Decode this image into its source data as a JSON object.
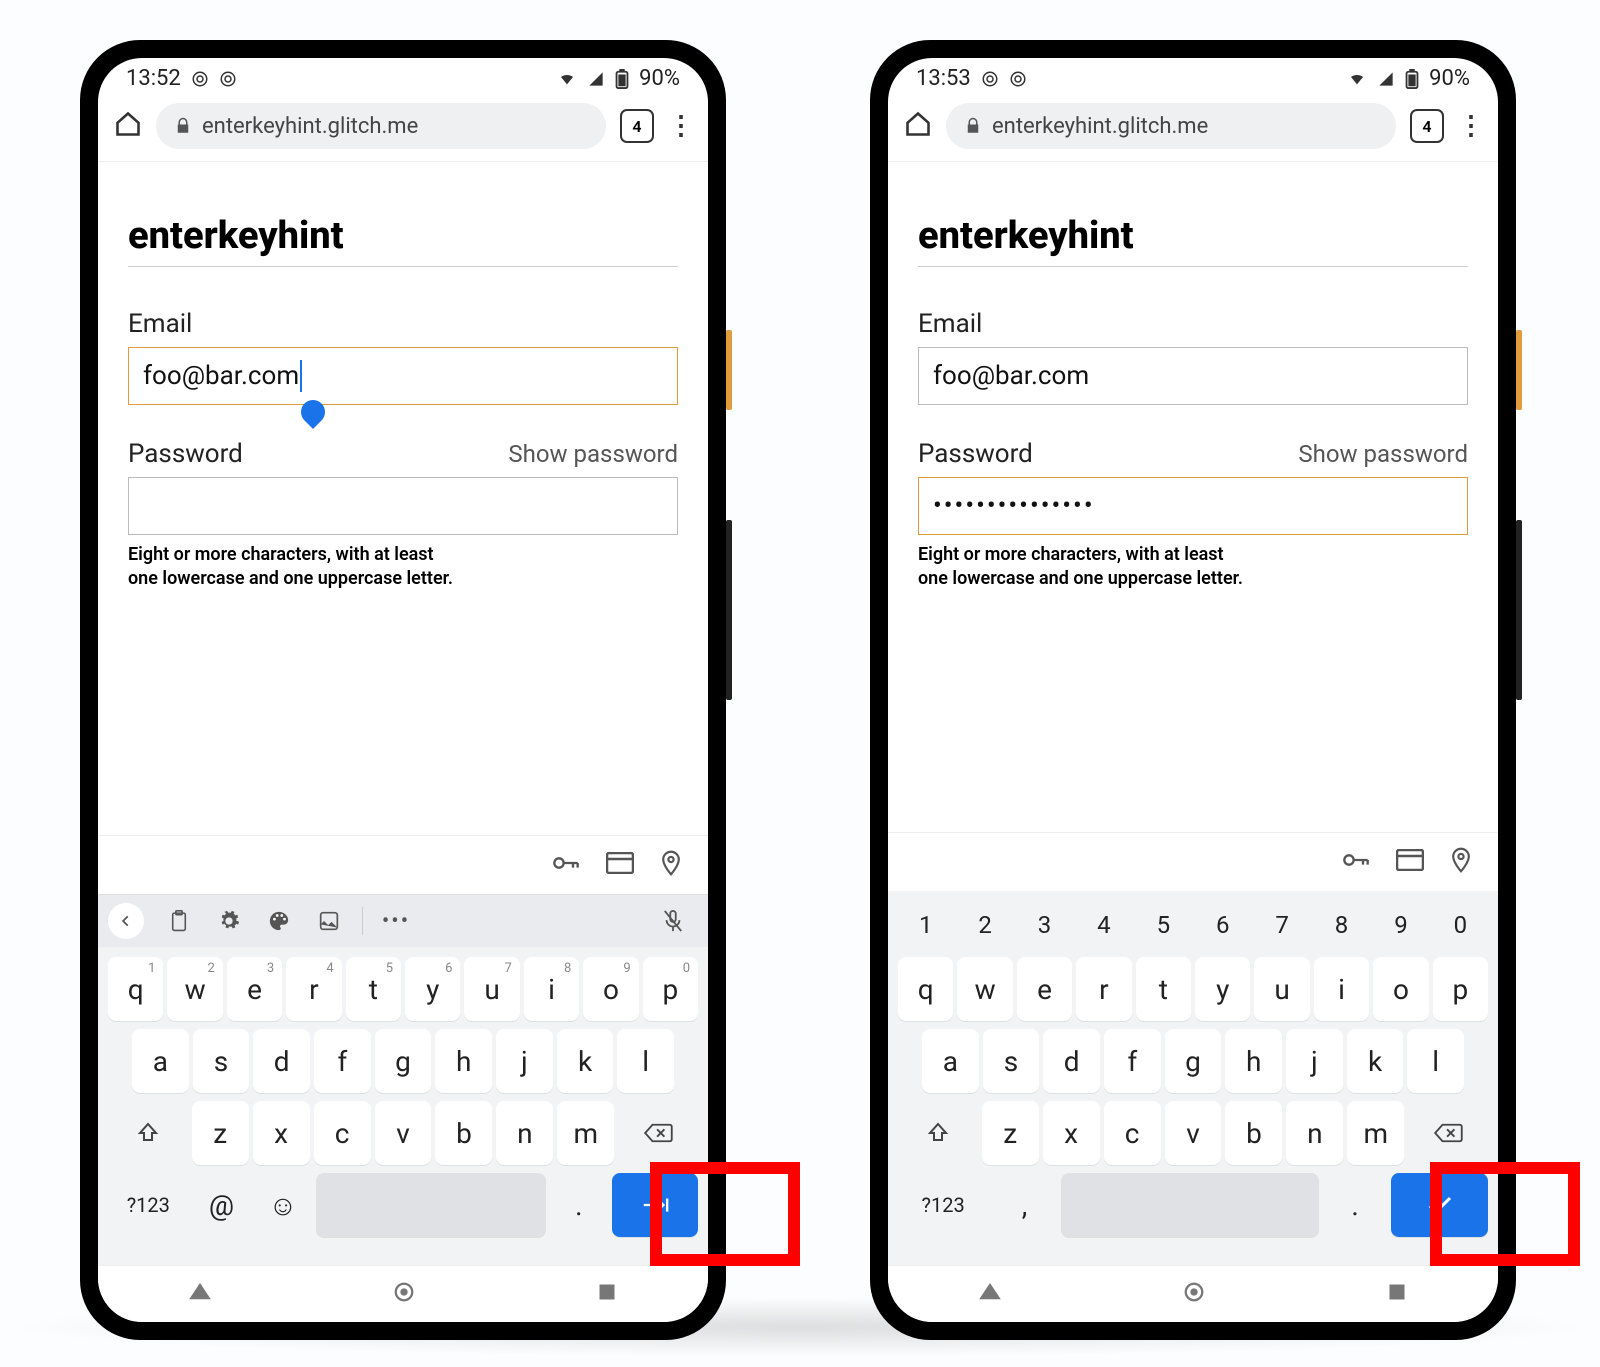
{
  "phones": {
    "left": {
      "status": {
        "time": "13:52",
        "battery": "90%"
      },
      "url": "enterkeyhint.glitch.me",
      "tab_count": "4",
      "page": {
        "title": "enterkeyhint",
        "email_label": "Email",
        "email_value": "foo@bar.com",
        "password_label": "Password",
        "show_password": "Show password",
        "password_value": "",
        "hint_line1": "Eight or more characters, with at least",
        "hint_line2": "one lowercase and one uppercase letter."
      },
      "keyboard": {
        "row1": [
          "q",
          "w",
          "e",
          "r",
          "t",
          "y",
          "u",
          "i",
          "o",
          "p"
        ],
        "row1_sup": [
          "1",
          "2",
          "3",
          "4",
          "5",
          "6",
          "7",
          "8",
          "9",
          "0"
        ],
        "row2": [
          "a",
          "s",
          "d",
          "f",
          "g",
          "h",
          "j",
          "k",
          "l"
        ],
        "row3": [
          "z",
          "x",
          "c",
          "v",
          "b",
          "n",
          "m"
        ],
        "sym": "?123",
        "at": "@",
        "period": ".",
        "enter_icon": "next"
      }
    },
    "right": {
      "status": {
        "time": "13:53",
        "battery": "90%"
      },
      "url": "enterkeyhint.glitch.me",
      "tab_count": "4",
      "page": {
        "title": "enterkeyhint",
        "email_label": "Email",
        "email_value": "foo@bar.com",
        "password_label": "Password",
        "show_password": "Show password",
        "password_value": "•••••••••••••••",
        "hint_line1": "Eight or more characters, with at least",
        "hint_line2": "one lowercase and one uppercase letter."
      },
      "keyboard": {
        "numrow": [
          "1",
          "2",
          "3",
          "4",
          "5",
          "6",
          "7",
          "8",
          "9",
          "0"
        ],
        "row1": [
          "q",
          "w",
          "e",
          "r",
          "t",
          "y",
          "u",
          "i",
          "o",
          "p"
        ],
        "row2": [
          "a",
          "s",
          "d",
          "f",
          "g",
          "h",
          "j",
          "k",
          "l"
        ],
        "row3": [
          "z",
          "x",
          "c",
          "v",
          "b",
          "n",
          "m"
        ],
        "sym": "?123",
        "comma": ",",
        "period": ".",
        "enter_icon": "done"
      }
    }
  }
}
